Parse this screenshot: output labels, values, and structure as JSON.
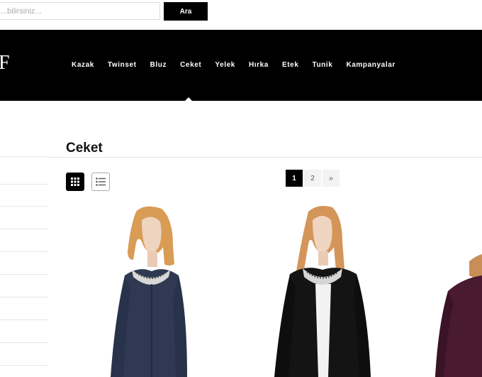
{
  "search": {
    "placeholder": "...bilirsiniz...",
    "button_label": "Ara"
  },
  "header": {
    "logo_text": "F",
    "nav_items": [
      "Kazak",
      "Twinset",
      "Bluz",
      "Ceket",
      "Yelek",
      "Hırka",
      "Etek",
      "Tunik",
      "Kampanyalar"
    ],
    "active_item": "Ceket"
  },
  "main": {
    "title": "Ceket",
    "view_modes": [
      "grid-icon",
      "list-icon"
    ],
    "pagination": {
      "pages": [
        "1",
        "2",
        "»"
      ],
      "current": "1"
    }
  },
  "products": [
    {
      "name": "navy-cardigan-image",
      "color": "#2f3a52"
    },
    {
      "name": "black-cardigan-image",
      "color": "#141414"
    },
    {
      "name": "plum-cardigan-image",
      "color": "#4a1a30"
    }
  ],
  "colors": {
    "nav_bg": "#000000",
    "accent": "#000000"
  }
}
